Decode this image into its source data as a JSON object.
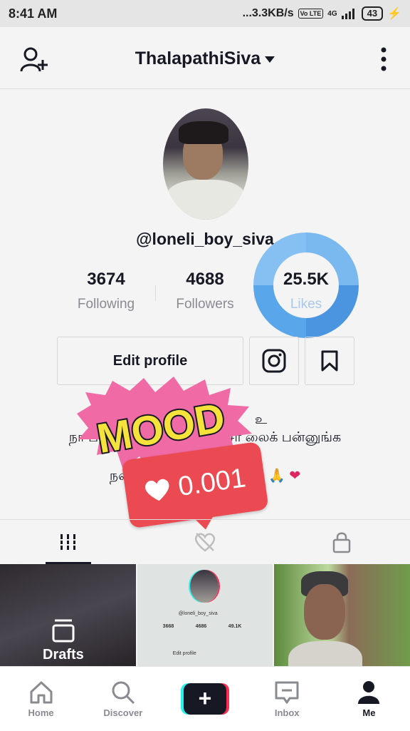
{
  "status": {
    "time": "8:41 AM",
    "speed": "...3.3KB/s",
    "volte": "Vo LTE",
    "network": "4G",
    "battery": "43"
  },
  "header": {
    "username": "ThalapathiSiva"
  },
  "profile": {
    "handle": "@loneli_boy_siva",
    "stats": [
      {
        "value": "3674",
        "label": "Following"
      },
      {
        "value": "4688",
        "label": "Followers"
      },
      {
        "value": "25.5K",
        "label": "Likes"
      }
    ],
    "edit_label": "Edit profile",
    "bio_line1": "நா ப",
    "bio_line1_end": "சா லைக் பன்னுங்க",
    "bio_line2": "நன்றி 4",
    "bio_emoji": "🙏",
    "bio_heart": "❤",
    "bio_fragment": "உ"
  },
  "sticker": {
    "mood_text": "MOOD",
    "counter_value": "0.001"
  },
  "grid": {
    "drafts_label": "Drafts",
    "thumb_handle": "@loneli_boy_siva",
    "thumb_stats": [
      "3668",
      "4686",
      "49.1K"
    ],
    "thumb_edit": "Edit profile"
  },
  "nav": [
    {
      "label": "Home",
      "icon": "home-icon"
    },
    {
      "label": "Discover",
      "icon": "search-icon"
    },
    {
      "label": "",
      "icon": "create-plus-icon"
    },
    {
      "label": "Inbox",
      "icon": "inbox-icon"
    },
    {
      "label": "Me",
      "icon": "person-icon"
    }
  ],
  "colors": {
    "accent_red": "#fe2c55",
    "accent_cyan": "#25f4ee",
    "ring_blue": "#4a94e0",
    "counter_red": "#ec4a53"
  }
}
